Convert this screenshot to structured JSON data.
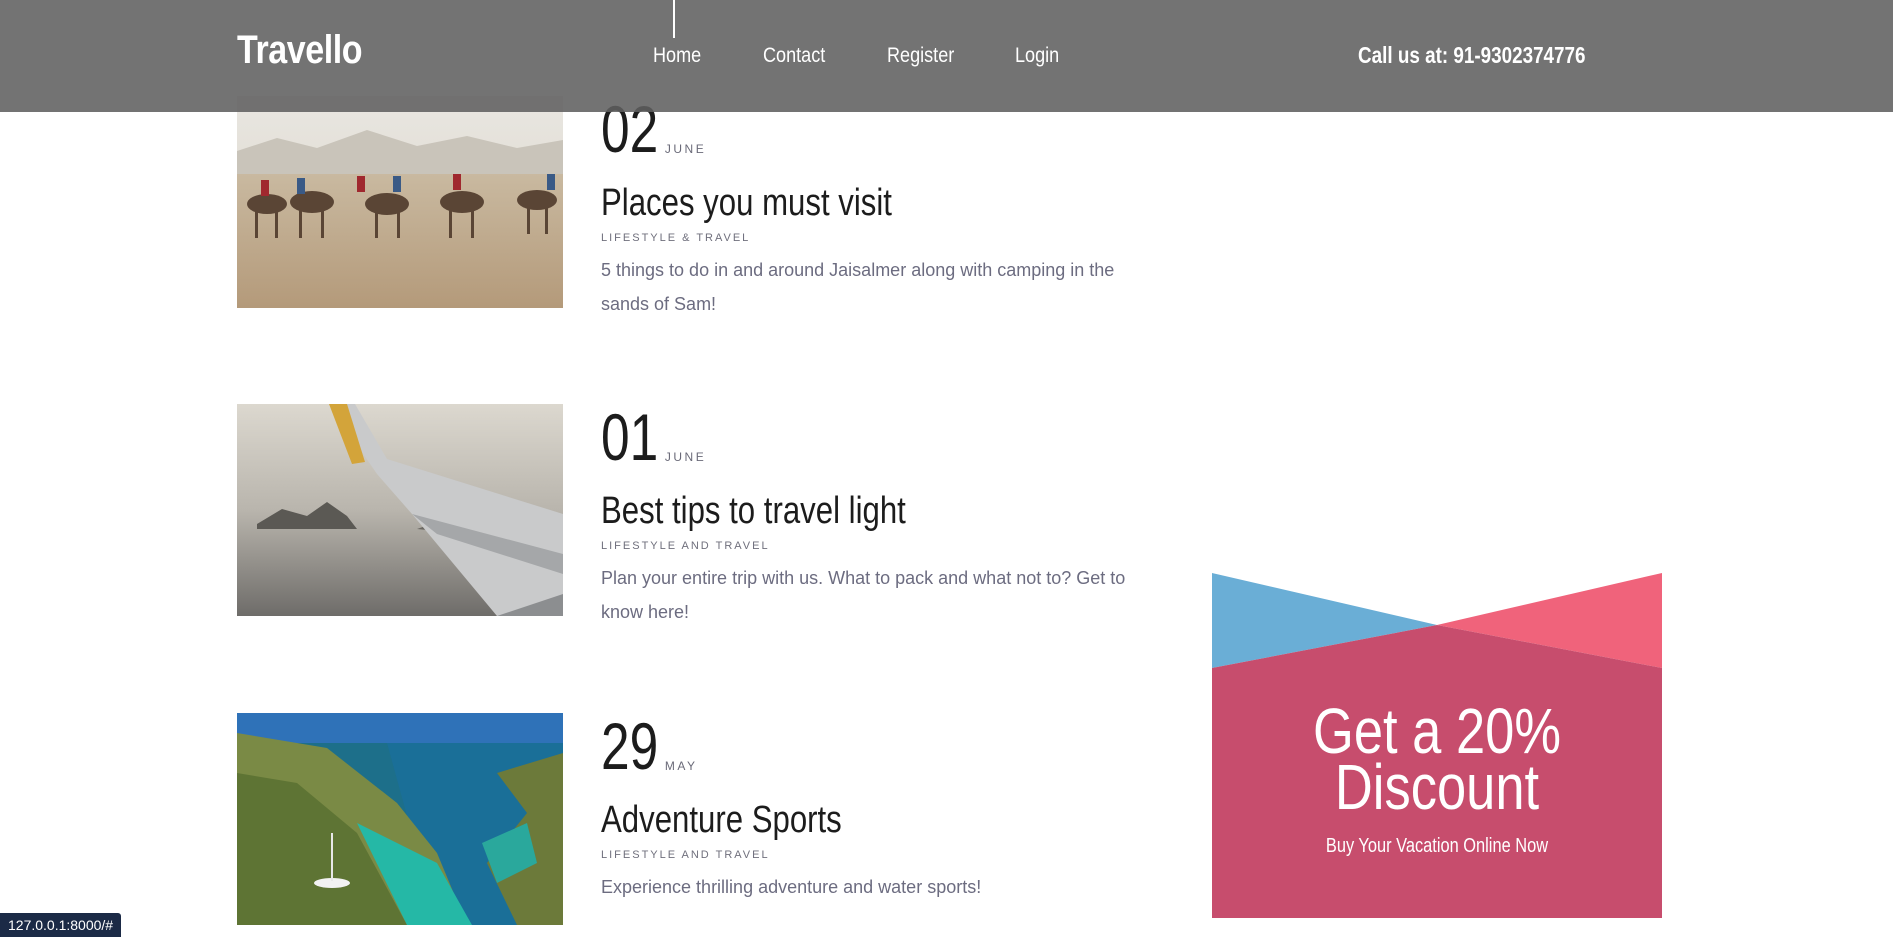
{
  "header": {
    "logo": "Travello",
    "nav": [
      {
        "label": "Home"
      },
      {
        "label": "Contact"
      },
      {
        "label": "Register"
      },
      {
        "label": "Login"
      }
    ],
    "phone": "Call us at: 91-9302374776"
  },
  "posts": [
    {
      "day": "02",
      "month": "JUNE",
      "title": "Places you must visit",
      "category": "LIFESTYLE & TRAVEL",
      "excerpt": "5 things to do in and around Jaisalmer along with camping in the sands of Sam!"
    },
    {
      "day": "01",
      "month": "JUNE",
      "title": "Best tips to travel light",
      "category": "LIFESTYLE AND TRAVEL",
      "excerpt": "Plan your entire trip with us. What to pack and what not to? Get to know here!"
    },
    {
      "day": "29",
      "month": "MAY",
      "title": "Adventure Sports",
      "category": "LIFESTYLE AND TRAVEL",
      "excerpt": "Experience thrilling adventure and water sports!"
    }
  ],
  "promo": {
    "title_line1": "Get a 20%",
    "title_line2": "Discount",
    "subtitle": "Buy Your Vacation Online Now",
    "colors": {
      "blue": "#6aaed6",
      "pink": "#f0637b",
      "main": "#c74d6d"
    }
  },
  "status_bar": {
    "url": "127.0.0.1:8000/#"
  }
}
